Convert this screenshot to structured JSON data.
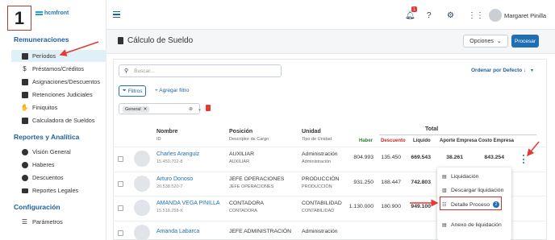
{
  "step_number": "1",
  "logo_text": "hcmfront",
  "sidebar": {
    "sections": [
      {
        "title": "Remuneraciones",
        "items": [
          {
            "label": "Períodos",
            "icon": "calendar-icon",
            "active": true
          },
          {
            "label": "Préstamos/Créditos",
            "icon": "dollar-icon"
          },
          {
            "label": "Asignaciones/Descuentos",
            "icon": "grid-icon"
          },
          {
            "label": "Retenciones Judiciales",
            "icon": "gavel-icon"
          },
          {
            "label": "Finiquitos",
            "icon": "handshake-icon"
          },
          {
            "label": "Calculadora de Sueldos",
            "icon": "calculator-icon"
          }
        ]
      },
      {
        "title": "Reportes y Analítica",
        "items": [
          {
            "label": "Visión General",
            "icon": "dollar-circle-icon"
          },
          {
            "label": "Haberes",
            "icon": "plus-circle-icon"
          },
          {
            "label": "Descuentos",
            "icon": "minus-circle-icon"
          },
          {
            "label": "Reportes Legales",
            "icon": "folder-icon"
          }
        ]
      },
      {
        "title": "Configuración",
        "items": [
          {
            "label": "Parámetros",
            "icon": "sliders-icon"
          }
        ]
      }
    ]
  },
  "topbar": {
    "notification_count": "1",
    "username": "Margaret Pinilla"
  },
  "header": {
    "title": "Cálculo de Sueldo",
    "options_label": "Opciones",
    "process_label": "Procesar"
  },
  "toolbar": {
    "search_placeholder": "Buscar...",
    "sort_label": "Ordenar por Defecto",
    "filters_label": "Filtros",
    "add_filter_label": "+ Agregar filtro",
    "chip_label": "General"
  },
  "table": {
    "headers": {
      "nombre": "Nombre",
      "id": "ID",
      "posicion": "Posición",
      "descriptor": "Descriptor de Cargo",
      "unidad": "Unidad",
      "tipo_unidad": "Tipo de Unidad",
      "total": "Total",
      "haber": "Haber",
      "descuento": "Descuento",
      "liquido": "Líquido",
      "aporte": "Aporte Empresa",
      "costo": "Costo Empresa"
    },
    "rows": [
      {
        "name": "Charles Aranguiz",
        "id": "15.450.702-8",
        "position": "AUXILIAR",
        "position_sub": "AUXILIAR",
        "unit": "Administración",
        "unit_sub": "Administración",
        "haber": "804.993",
        "descuento": "135.450",
        "liquido": "669.543",
        "aporte": "38.261",
        "costo": "843.254"
      },
      {
        "name": "Arturo Donoso",
        "id": "20.538.520-7",
        "position": "JEFE OPERACIONES",
        "position_sub": "JEFE OPERACIONES",
        "unit": "PRODUCCIÓN",
        "unit_sub": "PRODUCCIÓN",
        "haber": "931.250",
        "descuento": "188.447",
        "liquido": "742.803",
        "aporte": "",
        "costo": ""
      },
      {
        "name": "AMANDA VEGA PINILLA",
        "id": "15.518.258-K",
        "position": "CONTADORA",
        "position_sub": "CONTADORA",
        "unit": "CONTABILIDAD",
        "unit_sub": "CONTABILIDAD",
        "haber": "1.130.000",
        "descuento": "180.900",
        "liquido": "949.100",
        "aporte": "",
        "costo": ""
      },
      {
        "name": "Amanda Labarca",
        "id": "",
        "position": "JEFE ADMINISTRACIÓN",
        "position_sub": "",
        "unit": "Administración",
        "unit_sub": "",
        "haber": "",
        "descuento": "",
        "liquido": "",
        "aporte": "",
        "costo": ""
      }
    ]
  },
  "menu": {
    "items": [
      {
        "label": "Liquidación",
        "icon": "doc-icon"
      },
      {
        "label": "Descargar liquidación",
        "icon": "download-doc-icon"
      },
      {
        "label": "Detalle Proceso",
        "icon": "list-icon",
        "badge": "2"
      },
      {
        "label": "Anexo de liquidación",
        "icon": "doc-icon"
      }
    ]
  },
  "colors": {
    "accent": "#1f6fb2",
    "arrow": "#e53935",
    "active_bg": "#dff0f6"
  }
}
